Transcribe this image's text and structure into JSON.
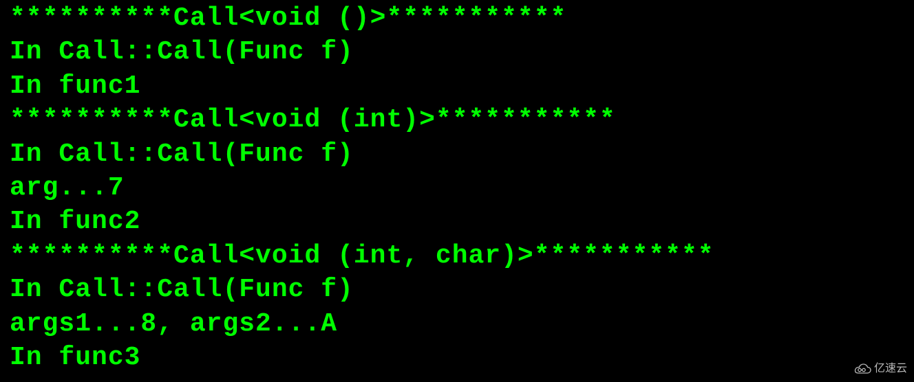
{
  "terminal": {
    "lines": [
      "**********Call<void ()>***********",
      "In Call::Call(Func f)",
      "In func1",
      "**********Call<void (int)>***********",
      "In Call::Call(Func f)",
      "arg...7",
      "In func2",
      "**********Call<void (int, char)>***********",
      "In Call::Call(Func f)",
      "args1...8, args2...A",
      "In func3"
    ]
  },
  "watermark": {
    "text": "亿速云"
  }
}
